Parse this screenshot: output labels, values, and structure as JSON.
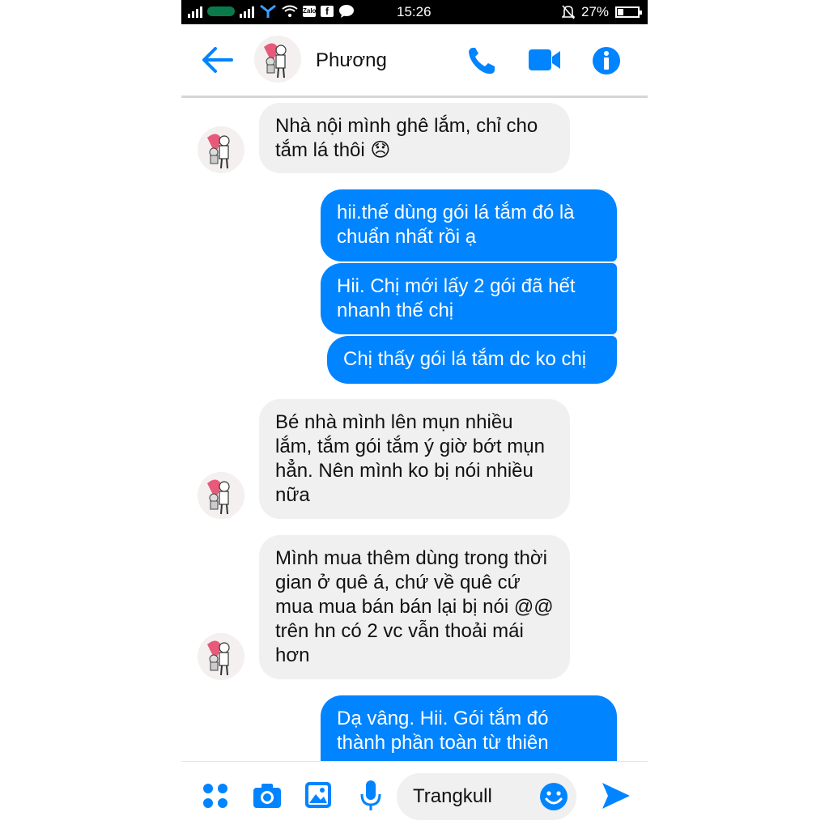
{
  "status_bar": {
    "time": "15:26",
    "battery_percent": "27%",
    "carrier_badge": "VIETTEL",
    "notification_apps": [
      "Zalo",
      "Facebook",
      "Messenger-bubble"
    ],
    "icons": [
      "signal-icon",
      "carrier-icon",
      "signal-icon",
      "network-icon",
      "wifi-icon",
      "zalo-icon",
      "facebook-icon",
      "chat-icon",
      "mute-icon",
      "battery-icon"
    ]
  },
  "header": {
    "contact_name": "Phương",
    "icons": [
      "back-arrow-icon",
      "phone-icon",
      "video-camera-icon",
      "info-icon"
    ]
  },
  "messages": [
    {
      "from": "them",
      "text": "Nhà nội mình ghê lắm, chỉ cho tắm lá thôi 😞"
    },
    {
      "from": "me",
      "text": "hii.thế dùng gói lá tắm đó là chuẩn nhất rồi ạ"
    },
    {
      "from": "me",
      "text": "Hii. Chị mới lấy 2 gói đã hết nhanh thế chị"
    },
    {
      "from": "me",
      "text": "Chị thấy gói lá tắm dc ko chị"
    },
    {
      "from": "them",
      "text": "Bé nhà mình lên mụn nhiều lắm, tắm gói tắm ý giờ bớt mụn hẳn. Nên mình ko bị nói nhiều nữa"
    },
    {
      "from": "them",
      "text": "Mình mua thêm dùng trong thời gian ở quê á, chứ về quê cứ mua mua bán bán lại bị nói @@ trên hn có 2 vc vẫn thoải mái hơn"
    },
    {
      "from": "me",
      "text": "Dạ vâng. Hii. Gói tắm đó thành phần toàn từ thiên"
    }
  ],
  "composer": {
    "input_value": "Trangkull",
    "icons": [
      "apps-grid-icon",
      "camera-icon",
      "image-icon",
      "microphone-icon",
      "emoji-icon",
      "send-icon"
    ]
  },
  "colors": {
    "accent": "#0084ff",
    "incoming_bubble": "#f0f0f0",
    "status_bar": "#000000"
  }
}
